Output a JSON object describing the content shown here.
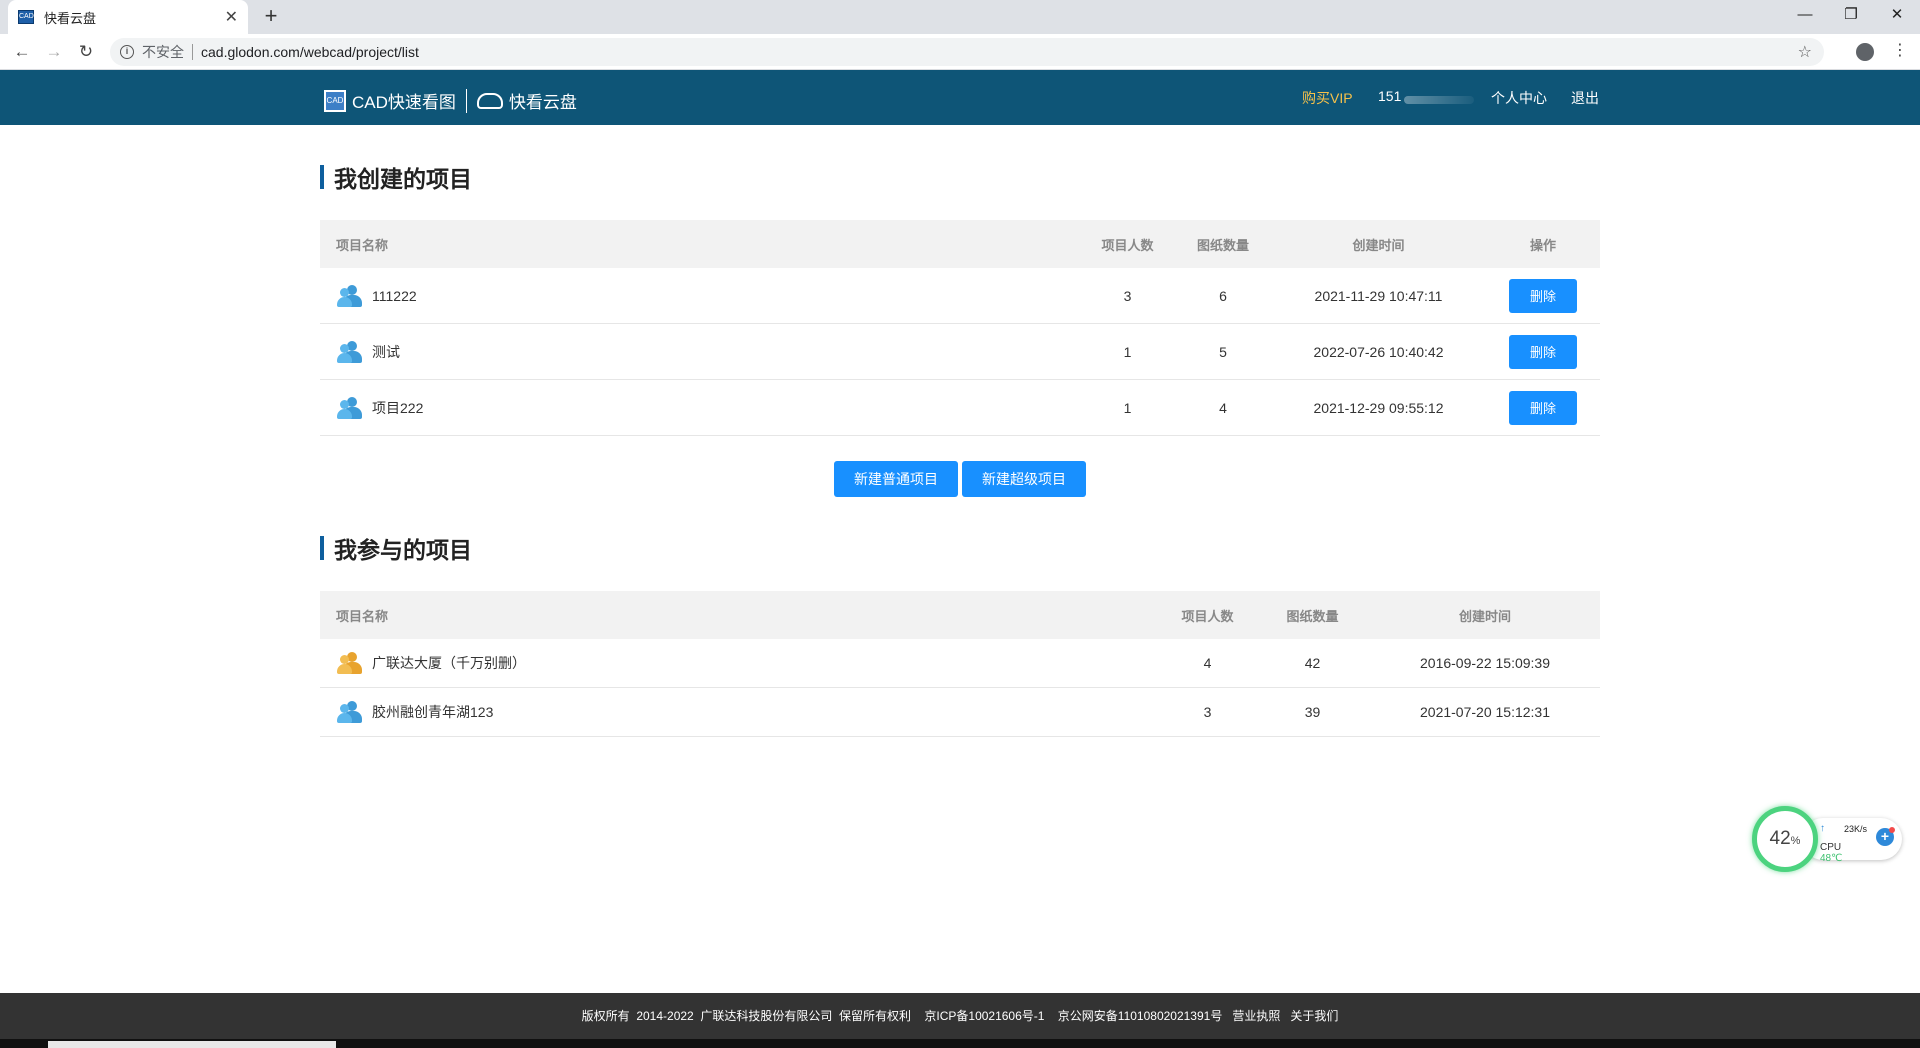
{
  "browser": {
    "tab_title": "快看云盘",
    "tab_favicon_text": "CAD",
    "insecure_label": "不安全",
    "url": "cad.glodon.com/webcad/project/list"
  },
  "header": {
    "logo_box_text": "CAD",
    "app_name": "CAD快速看图",
    "cloud_name": "快看云盘",
    "vip": "购买VIP",
    "user": "151",
    "profile": "个人中心",
    "logout": "退出",
    "colors": {
      "header_bg": "#0e5577",
      "vip": "#f5c14b",
      "primary_button": "#1890ff"
    }
  },
  "created": {
    "title": "我创建的项目",
    "columns": {
      "name": "项目名称",
      "members": "项目人数",
      "drawings": "图纸数量",
      "created": "创建时间",
      "action": "操作"
    },
    "rows": [
      {
        "name": "111222",
        "members": "3",
        "drawings": "6",
        "created": "2021-11-29 10:47:11",
        "action": "删除"
      },
      {
        "name": "测试",
        "members": "1",
        "drawings": "5",
        "created": "2022-07-26 10:40:42",
        "action": "删除"
      },
      {
        "name": "项目222",
        "members": "1",
        "drawings": "4",
        "created": "2021-12-29 09:55:12",
        "action": "删除"
      }
    ],
    "new_normal": "新建普通项目",
    "new_super": "新建超级项目"
  },
  "joined": {
    "title": "我参与的项目",
    "columns": {
      "name": "项目名称",
      "members": "项目人数",
      "drawings": "图纸数量",
      "created": "创建时间"
    },
    "rows": [
      {
        "name": "广联达大厦（千万别删）",
        "members": "4",
        "drawings": "42",
        "created": "2016-09-22 15:09:39",
        "icon": "gold-people-icon"
      },
      {
        "name": "胶州融创青年湖123",
        "members": "3",
        "drawings": "39",
        "created": "2021-07-20 15:12:31",
        "icon": "blue-people-icon"
      }
    ]
  },
  "footer": {
    "text": "版权所有  2014-2022  广联达科技股份有限公司  保留所有权利    京ICP备10021606号-1    京公网安备11010802021391号   营业执照   关于我们"
  },
  "cpu_widget": {
    "percent": "42",
    "percent_unit": "%",
    "net_speed": "23K/s",
    "cpu_label": "CPU",
    "temp": "48℃"
  }
}
